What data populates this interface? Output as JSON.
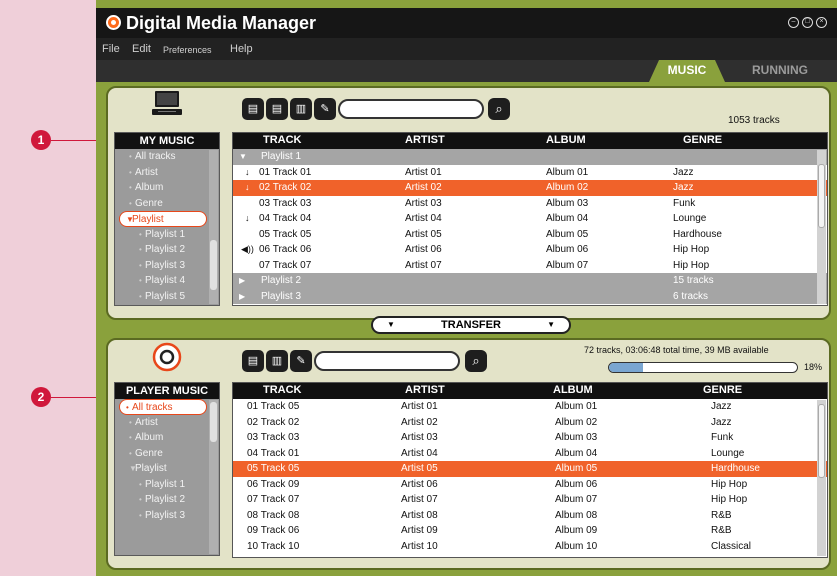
{
  "app": {
    "title": "Digital Media Manager",
    "window_controls": [
      "minimize-icon",
      "maximize-icon",
      "close-icon"
    ]
  },
  "menu": [
    "File",
    "Edit",
    "Preferences",
    "Help"
  ],
  "tabs": [
    {
      "label": "MUSIC",
      "active": true
    },
    {
      "label": "RUNNING",
      "active": false
    }
  ],
  "callouts": [
    "1",
    "2"
  ],
  "my_music": {
    "track_count": "1053 tracks",
    "icon": "computer-icon",
    "toolbar_icons": [
      "new-playlist-icon",
      "transfer-to-player-icon",
      "delete-icon",
      "edit-icon"
    ],
    "search_placeholder": "",
    "header": "MY MUSIC",
    "nav": [
      {
        "label": "All tracks",
        "level": 1
      },
      {
        "label": "Artist",
        "level": 1
      },
      {
        "label": "Album",
        "level": 1
      },
      {
        "label": "Genre",
        "level": 1
      },
      {
        "label": "Playlist",
        "level": 1,
        "selected": true
      },
      {
        "label": "Playlist 1",
        "level": 2
      },
      {
        "label": "Playlist 2",
        "level": 2
      },
      {
        "label": "Playlist 3",
        "level": 2
      },
      {
        "label": "Playlist 4",
        "level": 2
      },
      {
        "label": "Playlist 5",
        "level": 2
      }
    ],
    "columns": [
      "TRACK",
      "ARTIST",
      "ALBUM",
      "GENRE"
    ],
    "rows": [
      {
        "type": "group",
        "track": "Playlist 1",
        "genre": "",
        "expanded": true
      },
      {
        "icon": "↓",
        "track": "01  Track 01",
        "artist": "Artist 01",
        "album": "Album 01",
        "genre": "Jazz"
      },
      {
        "icon": "↓",
        "track": "02  Track 02",
        "artist": "Artist 02",
        "album": "Album 02",
        "genre": "Jazz",
        "selected": true
      },
      {
        "icon": "",
        "track": "03  Track 03",
        "artist": "Artist 03",
        "album": "Album 03",
        "genre": "Funk"
      },
      {
        "icon": "↓",
        "track": "04  Track 04",
        "artist": "Artist 04",
        "album": "Album 04",
        "genre": "Lounge"
      },
      {
        "icon": "",
        "track": "05  Track 05",
        "artist": "Artist 05",
        "album": "Album 05",
        "genre": "Hardhouse"
      },
      {
        "icon": "◀))",
        "track": "06  Track 06",
        "artist": "Artist 06",
        "album": "Album 06",
        "genre": "Hip Hop"
      },
      {
        "icon": "",
        "track": "07  Track 07",
        "artist": "Artist 07",
        "album": "Album 07",
        "genre": "Hip Hop"
      },
      {
        "type": "group",
        "track": "Playlist 2",
        "genre": "15 tracks",
        "expanded": false
      },
      {
        "type": "group",
        "track": "Playlist 3",
        "genre": "6 tracks",
        "expanded": false
      }
    ]
  },
  "transfer": {
    "label": "TRANSFER"
  },
  "player_music": {
    "icon": "player-icon",
    "toolbar_icons": [
      "new-playlist-icon",
      "delete-icon",
      "edit-icon"
    ],
    "status": "72 tracks, 03:06:48 total time, 39 MB available",
    "usage_percent": 18,
    "usage_label": "18%",
    "header": "PLAYER MUSIC",
    "nav": [
      {
        "label": "All tracks",
        "level": 1,
        "selected": true
      },
      {
        "label": "Artist",
        "level": 1
      },
      {
        "label": "Album",
        "level": 1
      },
      {
        "label": "Genre",
        "level": 1
      },
      {
        "label": "Playlist",
        "level": 1,
        "expanded": true
      },
      {
        "label": "Playlist 1",
        "level": 2
      },
      {
        "label": "Playlist 2",
        "level": 2
      },
      {
        "label": "Playlist 3",
        "level": 2
      }
    ],
    "columns": [
      "TRACK",
      "ARTIST",
      "ALBUM",
      "GENRE"
    ],
    "rows": [
      {
        "track": "01  Track 05",
        "artist": "Artist 01",
        "album": "Album 01",
        "genre": "Jazz"
      },
      {
        "track": "02  Track 02",
        "artist": "Artist 02",
        "album": "Album 02",
        "genre": "Jazz"
      },
      {
        "track": "03  Track 03",
        "artist": "Artist 03",
        "album": "Album 03",
        "genre": "Funk"
      },
      {
        "track": "04  Track 01",
        "artist": "Artist 04",
        "album": "Album 04",
        "genre": "Lounge"
      },
      {
        "track": "05  Track 05",
        "artist": "Artist 05",
        "album": "Album 05",
        "genre": "Hardhouse",
        "selected": true
      },
      {
        "track": "06  Track 09",
        "artist": "Artist 06",
        "album": "Album 06",
        "genre": "Hip Hop"
      },
      {
        "track": "07  Track 07",
        "artist": "Artist 07",
        "album": "Album 07",
        "genre": "Hip Hop"
      },
      {
        "track": "08  Track 08",
        "artist": "Artist 08",
        "album": "Album 08",
        "genre": "R&B"
      },
      {
        "track": "09  Track 06",
        "artist": "Artist 09",
        "album": "Album 09",
        "genre": "R&B"
      },
      {
        "track": "10  Track 10",
        "artist": "Artist 10",
        "album": "Album 10",
        "genre": "Classical"
      }
    ]
  },
  "colors": {
    "accent": "#8aa13c",
    "selection": "#f0622a",
    "callout": "#d0183b",
    "background": "#efcfd9"
  }
}
